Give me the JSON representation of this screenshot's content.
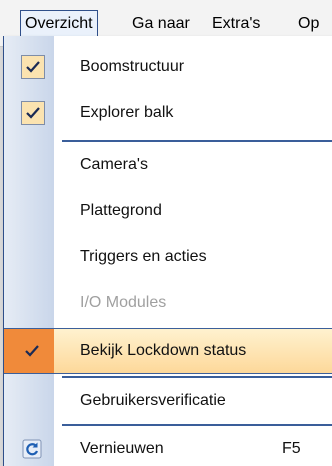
{
  "menubar": {
    "items": [
      {
        "label": "Overzicht",
        "active": true
      },
      {
        "label": "Ga naar"
      },
      {
        "label": "Extra's"
      },
      {
        "label": "Op"
      }
    ]
  },
  "menu": {
    "items": [
      {
        "label": "Boomstructuur",
        "checked": true
      },
      {
        "label": "Explorer balk",
        "checked": true
      },
      {
        "label": "Camera's"
      },
      {
        "label": "Plattegrond"
      },
      {
        "label": "Triggers en acties"
      },
      {
        "label": "I/O Modules",
        "disabled": true
      },
      {
        "label": "Bekijk Lockdown status",
        "checked": true,
        "highlighted": true
      },
      {
        "label": "Gebruikersverificatie"
      },
      {
        "label": "Vernieuwen",
        "shortcut": "F5",
        "icon": "refresh-icon"
      }
    ]
  },
  "colors": {
    "highlight_gutter": "#f08a3a",
    "highlight_bg": "#fdd89a",
    "separator": "#3a5e9a",
    "checkbox_bg": "#fbe3b0",
    "disabled_text": "#a0a0a0"
  }
}
